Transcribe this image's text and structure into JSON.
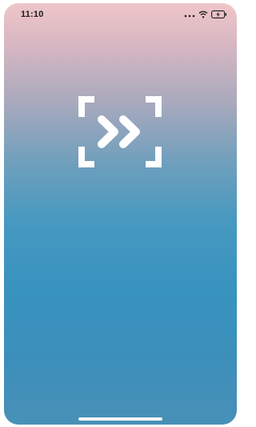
{
  "status_bar": {
    "time": "11:10",
    "icons": [
      "signal-dots-icon",
      "wifi-icon",
      "battery-charging-icon"
    ]
  },
  "splash": {
    "logo_icon": "double-chevron-scan-frame-icon"
  },
  "colors": {
    "gradient_top": "#efc6c9",
    "gradient_bottom": "#3893bf",
    "logo": "#ffffff",
    "status_text": "#1b1b1b"
  }
}
